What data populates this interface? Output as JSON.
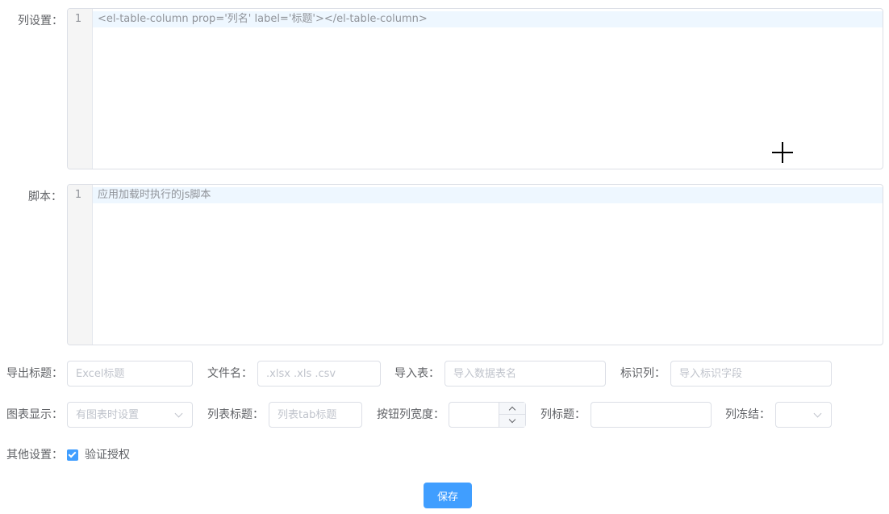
{
  "columns": {
    "label": "列设置：",
    "line_number": "1",
    "code": "<el-table-column prop='列名' label='标题'></el-table-column>"
  },
  "script": {
    "label": "脚本：",
    "line_number": "1",
    "placeholder": "应用加载时执行的js脚本"
  },
  "export_title": {
    "label": "导出标题：",
    "placeholder": "Excel标题"
  },
  "file_name": {
    "label": "文件名：",
    "placeholder": ".xlsx .xls .csv"
  },
  "import_table": {
    "label": "导入表：",
    "placeholder": "导入数据表名"
  },
  "identity_column": {
    "label": "标识列：",
    "placeholder": "导入标识字段"
  },
  "chart_display": {
    "label": "图表显示：",
    "placeholder": "有图表时设置"
  },
  "list_title": {
    "label": "列表标题：",
    "placeholder": "列表tab标题"
  },
  "button_column_width": {
    "label": "按钮列宽度：",
    "value": ""
  },
  "column_title": {
    "label": "列标题：",
    "value": ""
  },
  "column_freeze": {
    "label": "列冻结：",
    "value": ""
  },
  "other_settings": {
    "label": "其他设置：",
    "checkbox_label": "验证授权",
    "checked": true
  },
  "save_label": "保存",
  "colors": {
    "primary": "#409eff",
    "border": "#dcdfe6",
    "placeholder": "#c0c4cc"
  },
  "icons": [
    "chevron-down-icon",
    "checkmark-icon",
    "crosshair-cursor-icon"
  ]
}
